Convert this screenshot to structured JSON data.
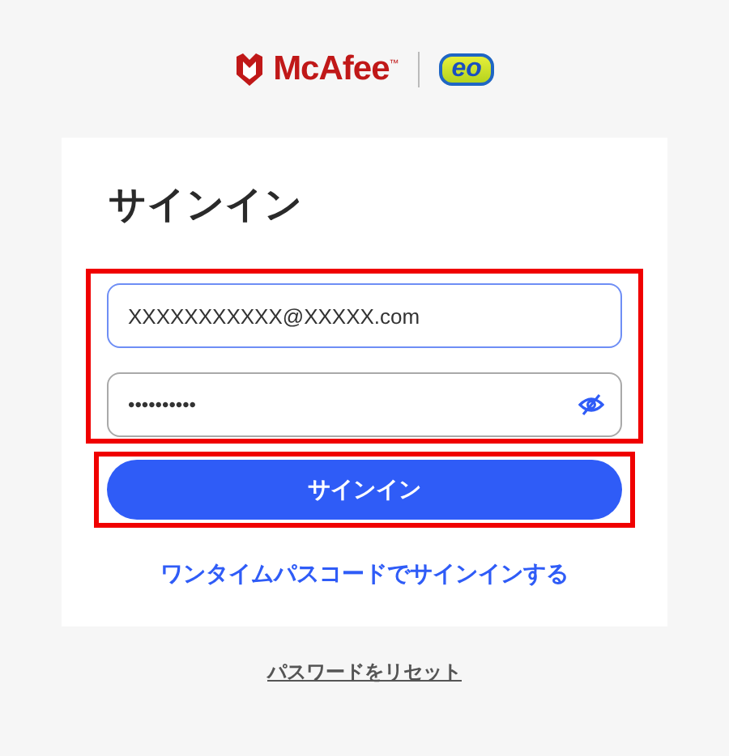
{
  "header": {
    "brand": "McAfee$^{™}$",
    "partner": "eo"
  },
  "signin": {
    "title": "サインイン",
    "email": {
      "value": "XXXXXXXXXXX@XXXXX.com",
      "focused": true
    },
    "password": {
      "value": "••••••••••",
      "masked": true
    },
    "submit": "サインイン",
    "otp_link": "ワンタイムパスコードでサインインする"
  },
  "reset_link": "パスワードをリセット",
  "highlights": {
    "fields": true,
    "submit": true
  }
}
